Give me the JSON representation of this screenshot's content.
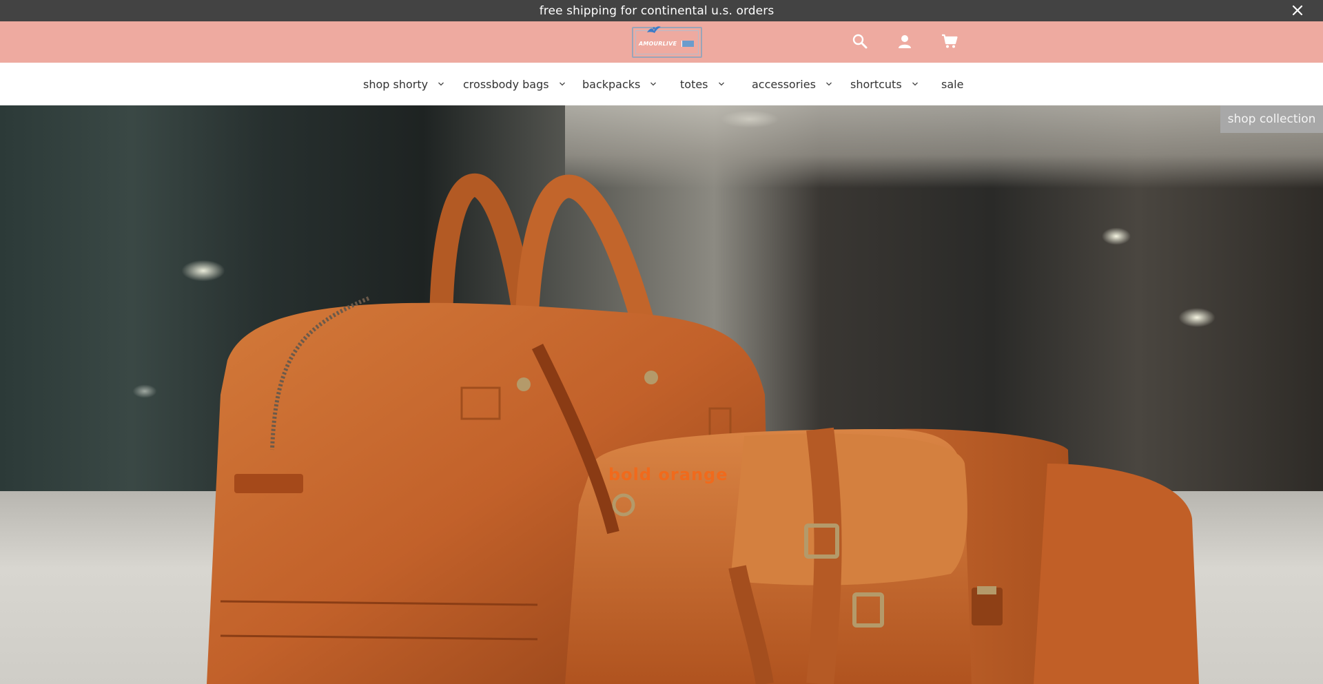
{
  "announcement": {
    "text": "free shipping for continental u.s. orders",
    "close_icon": "close-icon"
  },
  "header": {
    "logo_text": "AMOURLIVE",
    "icons": [
      "search-icon",
      "account-icon",
      "cart-icon"
    ],
    "background_color": "#eeaaa0"
  },
  "nav": {
    "items": [
      {
        "label": "shop shorty",
        "has_dropdown": true
      },
      {
        "label": "crossbody bags",
        "has_dropdown": true
      },
      {
        "label": "backpacks",
        "has_dropdown": true
      },
      {
        "label": "totes",
        "has_dropdown": true
      },
      {
        "label": "accessories",
        "has_dropdown": true
      },
      {
        "label": "shortcuts",
        "has_dropdown": true
      },
      {
        "label": "sale",
        "has_dropdown": false
      }
    ]
  },
  "hero": {
    "button_label": "shop collection",
    "caption": "bold orange",
    "caption_color": "#f06a1c",
    "image_subject": "orange leather bags"
  }
}
